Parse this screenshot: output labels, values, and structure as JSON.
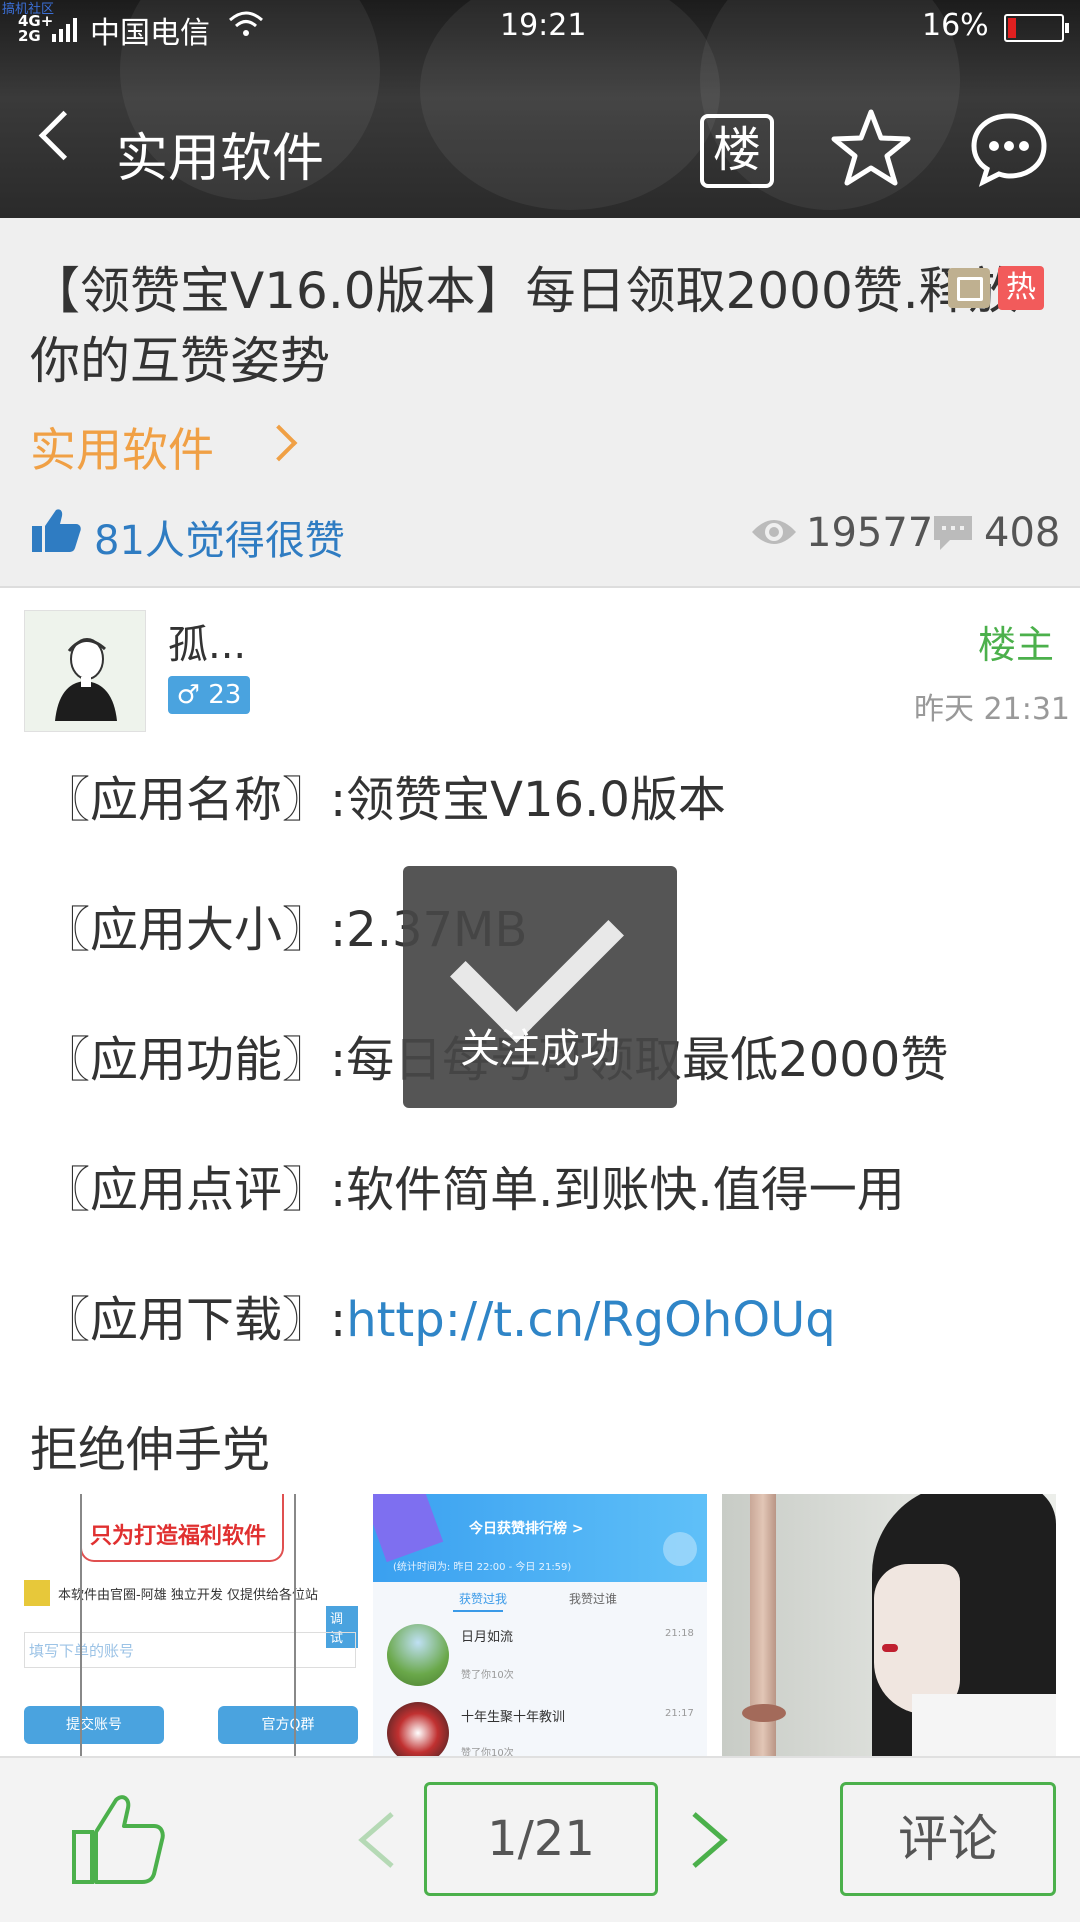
{
  "status_bar": {
    "watermark": "搞机社区",
    "network": "4G+\n2G",
    "carrier": "中国电信",
    "time": "19:21",
    "battery": "16%"
  },
  "header": {
    "title": "实用软件",
    "floor_button": "楼"
  },
  "post": {
    "title": "【领赞宝V16.0版本】每日领取2000赞.释放你的互赞姿势",
    "hot_badge": "热",
    "category": "实用软件",
    "likes_text": "81人觉得很赞",
    "views": "19577",
    "comments": "408"
  },
  "author": {
    "name": "孤...",
    "gender_badge": "♂ 23",
    "role": "楼主",
    "time": "昨天 21:31"
  },
  "content": {
    "line1": "〖应用名称〗:领赞宝V16.0版本",
    "line2": "〖应用大小〗:2.37MB",
    "line3": "〖应用功能〗:每日每号可领取最低2000赞",
    "line4": "〖应用点评〗:软件简单.到账快.值得一用",
    "line5_prefix": "〖应用下载〗:",
    "line5_link": "http://t.cn/RgOhOUq",
    "section_heading": "拒绝伸手党"
  },
  "images": {
    "thumb1": {
      "banner": "只为打造福利软件",
      "sub": "本软件由官圈-阿雄 独立开发 仅提供给各位站",
      "input_placeholder": "填写下单的账号",
      "btn_submit": "提交账号",
      "btn_group": "官方Q群",
      "tag": "调试"
    },
    "thumb2": {
      "header": "今日获赞排行榜 >",
      "subheader": "(统计时间为: 昨日 22:00 - 今日 21:59)",
      "tab1": "获赞过我",
      "tab2": "我赞过谁",
      "row1_name": "日月如流",
      "row1_time": "21:18",
      "row1_sub": "赞了你10次",
      "row2_name": "十年生聚十年教训",
      "row2_time": "21:17",
      "row2_sub": "赞了你10次"
    }
  },
  "toast": {
    "text": "关注成功"
  },
  "bottom_bar": {
    "page": "1/21",
    "comment_button": "评论"
  },
  "colors": {
    "accent_green": "#4bb04b",
    "category_orange": "#f0a045",
    "link_blue": "#2f85c7",
    "hot_red": "#f25b5b"
  }
}
